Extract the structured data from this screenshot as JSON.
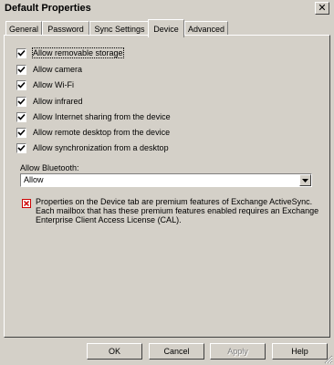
{
  "window": {
    "title": "Default Properties",
    "close_glyph": "✕"
  },
  "tabs": [
    {
      "label": "General"
    },
    {
      "label": "Password"
    },
    {
      "label": "Sync Settings"
    },
    {
      "label": "Device",
      "active": true
    },
    {
      "label": "Advanced"
    }
  ],
  "device": {
    "checkboxes": [
      {
        "label": "Allow removable storage",
        "checked": true
      },
      {
        "label": "Allow camera",
        "checked": true
      },
      {
        "label": "Allow Wi-Fi",
        "checked": true
      },
      {
        "label": "Allow infrared",
        "checked": true
      },
      {
        "label": "Allow Internet sharing from the device",
        "checked": true
      },
      {
        "label": "Allow remote desktop from the device",
        "checked": true
      },
      {
        "label": "Allow synchronization from a desktop",
        "checked": true
      }
    ],
    "bluetooth_label": "Allow Bluetooth:",
    "bluetooth_value": "Allow",
    "info_text": "Properties on the Device tab are premium features of Exchange ActiveSync. Each mailbox that has these premium features enabled requires an Exchange Enterprise Client Access License (CAL)."
  },
  "buttons": {
    "ok": "OK",
    "cancel": "Cancel",
    "apply": "Apply",
    "help": "Help"
  },
  "colors": {
    "face": "#d4d0c8",
    "info_icon": "#cc0000"
  }
}
